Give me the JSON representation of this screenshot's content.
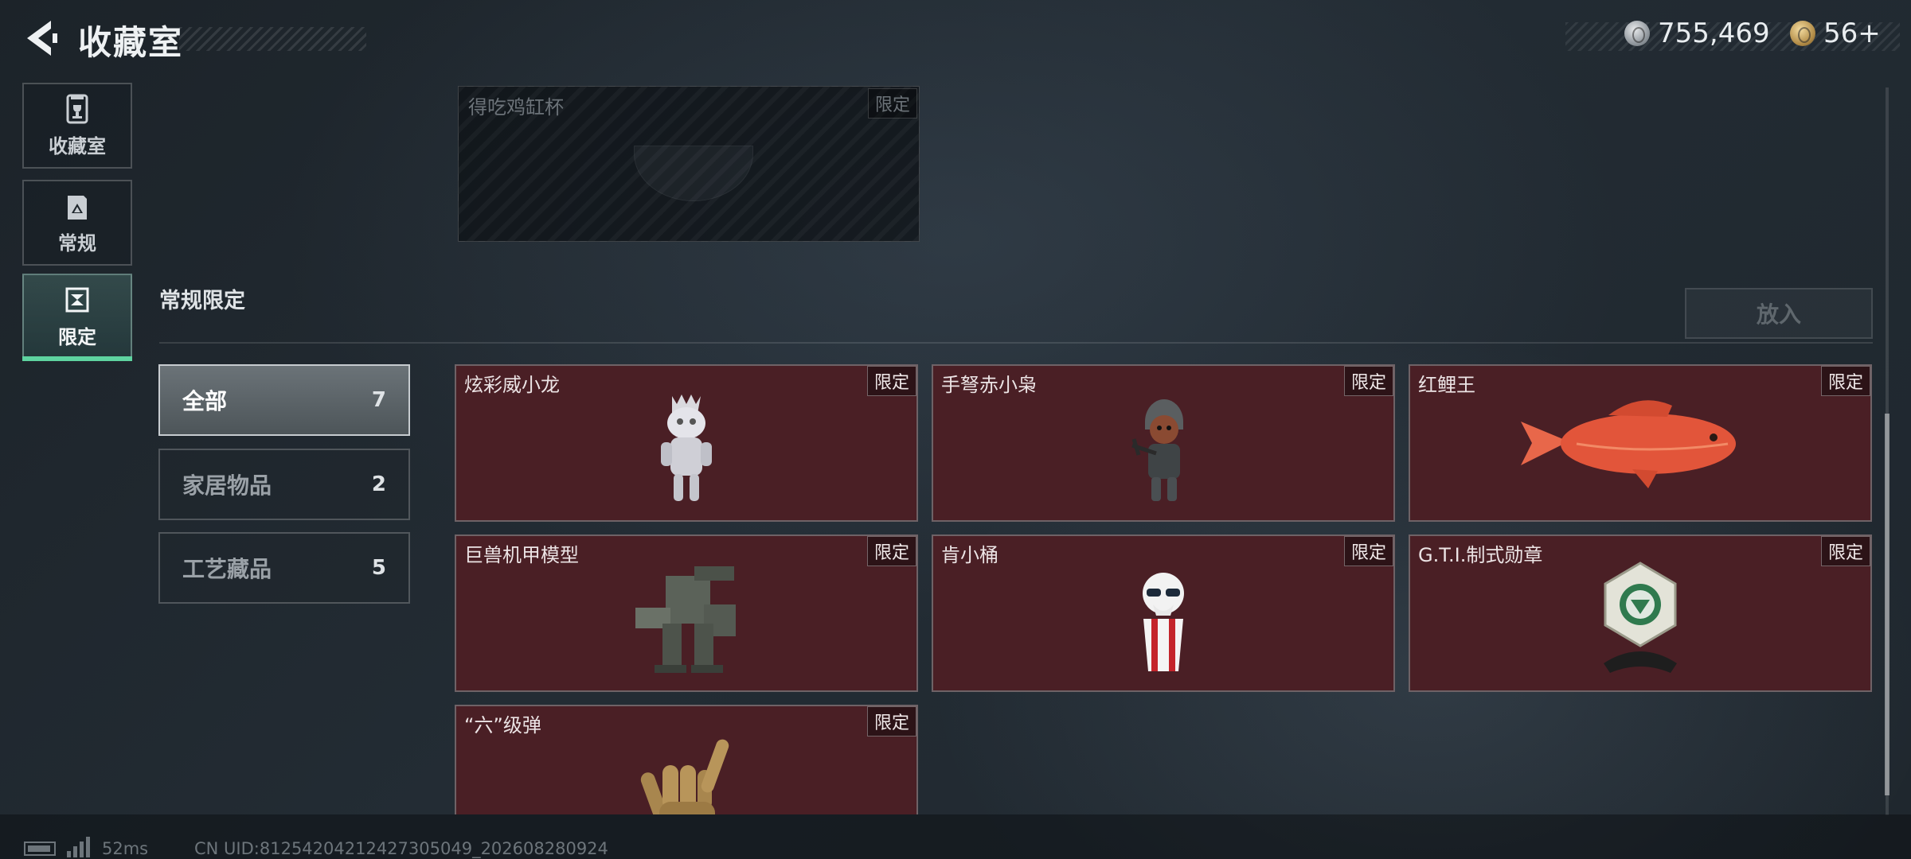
{
  "header": {
    "title": "收藏室",
    "currency_silver": "755,469",
    "currency_gold": "56+",
    "back_icon": "chevron-left-icon",
    "silver_icon": "silver-coin-icon",
    "gold_icon": "gold-coin-icon"
  },
  "nav": {
    "items": [
      {
        "label": "收藏室",
        "icon": "trophy-icon"
      },
      {
        "label": "常规",
        "icon": "picture-icon"
      },
      {
        "label": "限定",
        "icon": "limited-frame-icon"
      }
    ],
    "active_index": 2,
    "active_color": "#5ed3a0"
  },
  "top_card": {
    "name": "得吃鸡缸杯",
    "tag": "限定"
  },
  "section": {
    "title": "常规限定",
    "put_button": "放入"
  },
  "filters": [
    {
      "label": "全部",
      "count": "7"
    },
    {
      "label": "家居物品",
      "count": "2"
    },
    {
      "label": "工艺藏品",
      "count": "5"
    }
  ],
  "items": [
    {
      "name": "炫彩威小龙",
      "tag": "限定",
      "icon": "dragon-figure-icon"
    },
    {
      "name": "手弩赤小枭",
      "tag": "限定",
      "icon": "crossbow-figure-icon"
    },
    {
      "name": "红鲤王",
      "tag": "限定",
      "icon": "red-carp-icon"
    },
    {
      "name": "巨兽机甲模型",
      "tag": "限定",
      "icon": "mech-model-icon"
    },
    {
      "name": "肯小桶",
      "tag": "限定",
      "icon": "bucket-figure-icon"
    },
    {
      "name": "G.T.I.制式勋章",
      "tag": "限定",
      "icon": "medal-icon"
    },
    {
      "name": "“六”级弹",
      "tag": "限定",
      "icon": "hand-sign-icon"
    }
  ],
  "footer": {
    "ping": "52ms",
    "uid": "CN UID:8125420421242730504​9_202608280924",
    "battery_icon": "battery-icon",
    "signal_icon": "signal-bars-icon"
  }
}
